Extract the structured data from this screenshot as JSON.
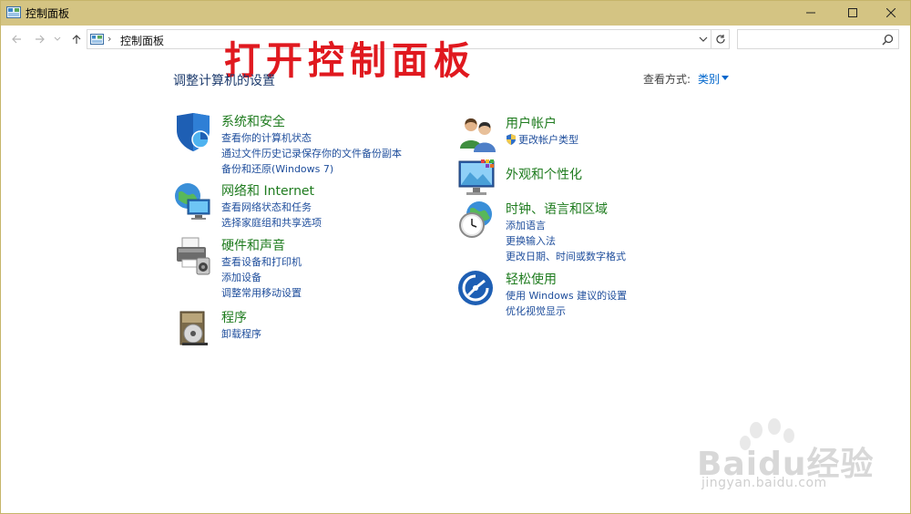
{
  "window": {
    "title": "控制面板"
  },
  "address": {
    "separator": "›",
    "breadcrumb": "控制面板",
    "search_placeholder": ""
  },
  "annotation": "打开控制面板",
  "heading": "调整计算机的设置",
  "view_by": {
    "label": "查看方式:",
    "value": "类别"
  },
  "left_categories": [
    {
      "title": "系统和安全",
      "icon": "shield-security-icon",
      "links": [
        "查看你的计算机状态",
        "通过文件历史记录保存你的文件备份副本",
        "备份和还原(Windows 7)"
      ]
    },
    {
      "title": "网络和 Internet",
      "icon": "network-globe-icon",
      "links": [
        "查看网络状态和任务",
        "选择家庭组和共享选项"
      ]
    },
    {
      "title": "硬件和声音",
      "icon": "printer-hardware-icon",
      "links": [
        "查看设备和打印机",
        "添加设备",
        "调整常用移动设置"
      ]
    },
    {
      "title": "程序",
      "icon": "programs-disc-icon",
      "links": [
        "卸载程序"
      ]
    }
  ],
  "right_categories": [
    {
      "title": "用户帐户",
      "icon": "users-icon",
      "links": [
        "更改帐户类型"
      ]
    },
    {
      "title": "外观和个性化",
      "icon": "monitor-appearance-icon",
      "links": []
    },
    {
      "title": "时钟、语言和区域",
      "icon": "clock-globe-icon",
      "links": [
        "添加语言",
        "更换输入法",
        "更改日期、时间或数字格式"
      ]
    },
    {
      "title": "轻松使用",
      "icon": "ease-of-access-icon",
      "links": [
        "使用 Windows 建议的设置",
        "优化视觉显示"
      ]
    }
  ],
  "watermark": {
    "text": "Baidu经验",
    "url": "jingyan.baidu.com"
  },
  "colors": {
    "titlebar": "#d4c483",
    "category_title": "#1e7b1e",
    "link": "#1f4e9c",
    "annotation": "#e0191f"
  }
}
